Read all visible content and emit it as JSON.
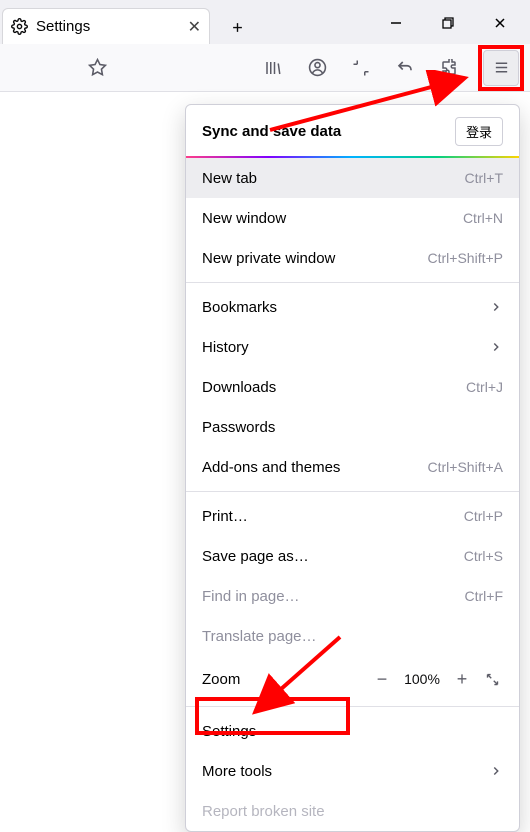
{
  "tab": {
    "title": "Settings"
  },
  "menu": {
    "header": "Sync and save data",
    "login": "登录",
    "items": {
      "newTab": {
        "label": "New tab",
        "shortcut": "Ctrl+T"
      },
      "newWindow": {
        "label": "New window",
        "shortcut": "Ctrl+N"
      },
      "newPrivate": {
        "label": "New private window",
        "shortcut": "Ctrl+Shift+P"
      },
      "bookmarks": {
        "label": "Bookmarks"
      },
      "history": {
        "label": "History"
      },
      "downloads": {
        "label": "Downloads",
        "shortcut": "Ctrl+J"
      },
      "passwords": {
        "label": "Passwords"
      },
      "addons": {
        "label": "Add-ons and themes",
        "shortcut": "Ctrl+Shift+A"
      },
      "print": {
        "label": "Print…",
        "shortcut": "Ctrl+P"
      },
      "savePage": {
        "label": "Save page as…",
        "shortcut": "Ctrl+S"
      },
      "findInPage": {
        "label": "Find in page…",
        "shortcut": "Ctrl+F"
      },
      "translate": {
        "label": "Translate page…"
      },
      "zoom": {
        "label": "Zoom",
        "value": "100%"
      },
      "settings": {
        "label": "Settings"
      },
      "moreTools": {
        "label": "More tools"
      },
      "reportBroken": {
        "label": "Report broken site"
      }
    }
  }
}
